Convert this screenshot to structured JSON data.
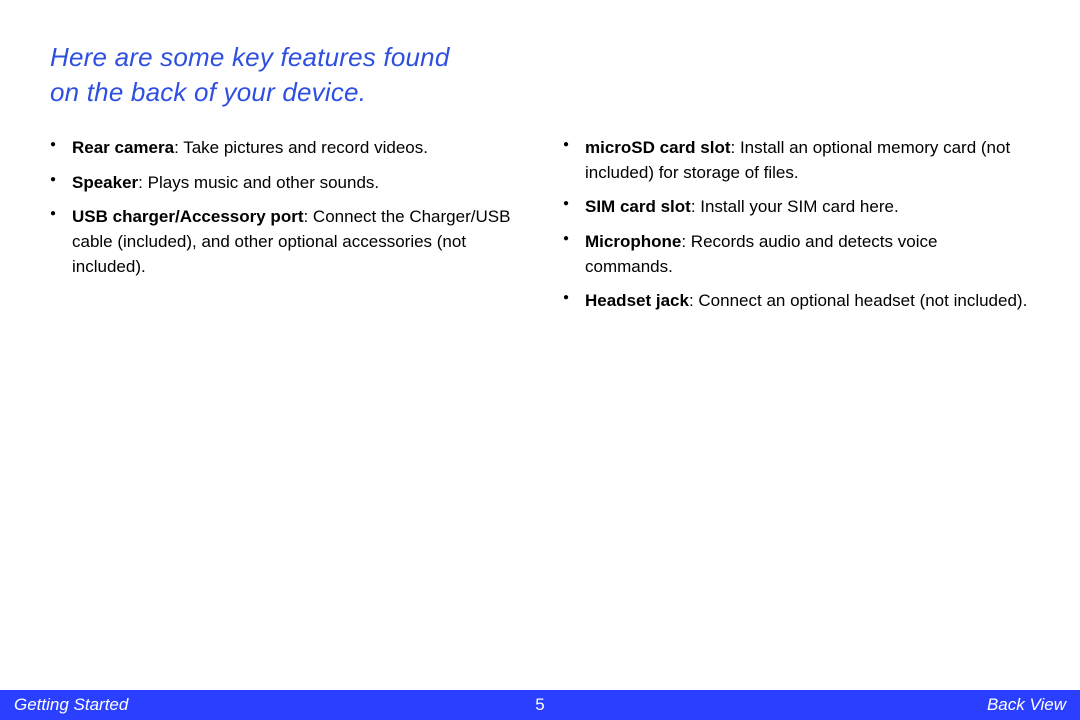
{
  "heading_line1": "Here are some key features found",
  "heading_line2": "on the back of your device.",
  "left_items": [
    {
      "term": "Rear camera",
      "desc": ": Take pictures and record videos."
    },
    {
      "term": "Speaker",
      "desc": ": Plays music and other sounds."
    },
    {
      "term": "USB charger/Accessory port",
      "desc": ": Connect the Charger/USB cable (included), and other optional accessories (not included)."
    }
  ],
  "right_items": [
    {
      "term": "microSD card slot",
      "desc": ": Install an optional memory card (not included) for storage of files."
    },
    {
      "term": "SIM card slot",
      "desc": ": Install your SIM card here."
    },
    {
      "term": "Microphone",
      "desc": ": Records audio and detects voice commands."
    },
    {
      "term": "Headset jack",
      "desc": ": Connect an optional headset (not included)."
    }
  ],
  "footer": {
    "left": "Getting Started",
    "page": "5",
    "right": "Back View"
  }
}
